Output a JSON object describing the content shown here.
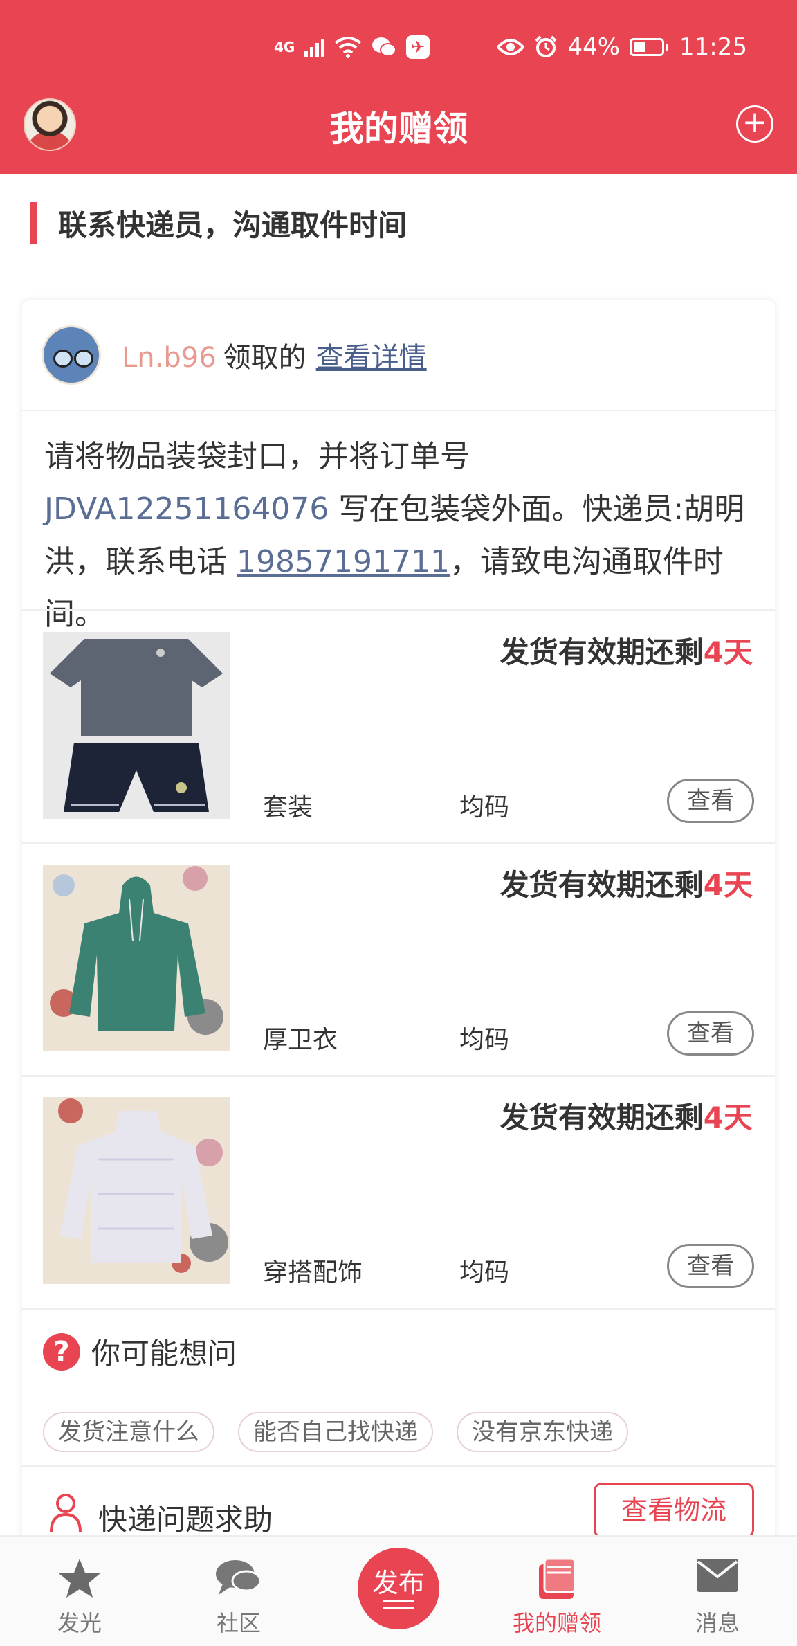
{
  "status_bar": {
    "network": "4G",
    "battery_percent": "44%",
    "battery_level": 0.44,
    "time": "11:25"
  },
  "header": {
    "title": "我的赠领"
  },
  "section": {
    "title": "联系快递员，沟通取件时间"
  },
  "claim": {
    "user": "Ln.b96",
    "verb": "领取的",
    "details_link": "查看详情"
  },
  "instructions": {
    "part1": "请将物品装袋封口，并将订单号 ",
    "order_no": "JDVA12251164076",
    "part2": " 写在包装袋外面。快递员:胡明洪，联系电话 ",
    "phone": "19857191711",
    "part3": "，请致电沟通取件时间。"
  },
  "items": [
    {
      "deadline_prefix": "发货有效期还剩",
      "days": "4天",
      "name": "套装",
      "size": "均码",
      "view_label": "查看"
    },
    {
      "deadline_prefix": "发货有效期还剩",
      "days": "4天",
      "name": "厚卫衣",
      "size": "均码",
      "view_label": "查看"
    },
    {
      "deadline_prefix": "发货有效期还剩",
      "days": "4天",
      "name": "穿搭配饰",
      "size": "均码",
      "view_label": "查看"
    }
  ],
  "faq": {
    "icon_label": "?",
    "title": "你可能想问",
    "chips": [
      "发货注意什么",
      "能否自己找快递",
      "没有京东快递"
    ]
  },
  "help": {
    "title": "快递问题求助",
    "button": "查看物流"
  },
  "tabbar": {
    "tabs": [
      {
        "label": "发光",
        "icon": "star-icon"
      },
      {
        "label": "社区",
        "icon": "chat-icon"
      },
      {
        "label": "我的赠领",
        "icon": "gift-book-icon",
        "active": true
      },
      {
        "label": "消息",
        "icon": "mail-icon"
      }
    ],
    "publish_label": "发布"
  },
  "colors": {
    "brand": "#e84452",
    "link": "#4a5e8c",
    "order_no": "#5a6d94"
  }
}
